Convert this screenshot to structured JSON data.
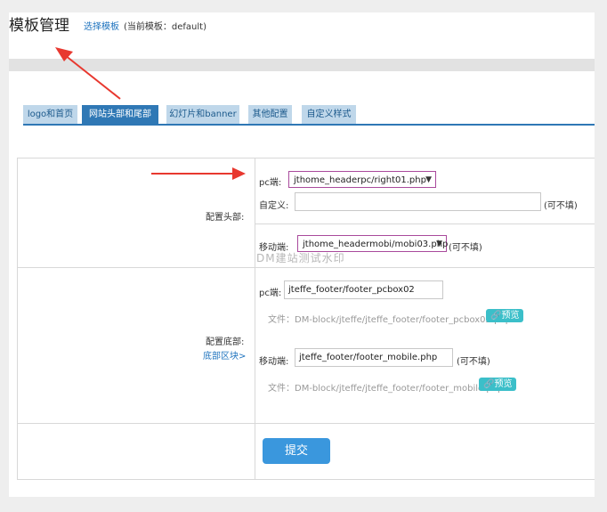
{
  "header": {
    "title": "模板管理",
    "select_link": "选择模板",
    "current_template": "(当前模板：default)"
  },
  "tabs": [
    {
      "label": "logo和首页",
      "active": false
    },
    {
      "label": "网站头部和尾部",
      "active": true
    },
    {
      "label": "幻灯片和banner",
      "active": false
    },
    {
      "label": "其他配置",
      "active": false
    },
    {
      "label": "自定义样式",
      "active": false
    }
  ],
  "header_config": {
    "label": "配置头部:",
    "pc_label": "pc端:",
    "pc_value": "jthome_headerpc/right01.php",
    "custom_label": "自定义:",
    "custom_value": "",
    "custom_hint": "(可不填)",
    "mobile_label": "移动端:",
    "mobile_value": "jthome_headermobi/mobi03.php",
    "mobile_hint": "(可不填)"
  },
  "footer_config": {
    "label": "配置底部:",
    "block_link": "底部区块>",
    "pc_label": "pc端:",
    "pc_value": "jteffe_footer/footer_pcbox02",
    "pc_file": "文件：DM-block/jteffe/jteffe_footer/footer_pcbox02.php",
    "mobile_label": "移动端:",
    "mobile_value": "jteffe_footer/footer_mobile.php",
    "mobile_hint": "(可不填)",
    "mobile_file": "文件：DM-block/jteffe/jteffe_footer/footer_mobile.php",
    "preview_label": "预览"
  },
  "submit_label": "提交",
  "watermark": "DM建站测试水印",
  "colors": {
    "accent": "#2f78b5",
    "tab_inactive": "#bfd7ea",
    "preview": "#3bbfc9",
    "submit": "#3a97dd",
    "arrow": "#e8382f",
    "select_border": "#a94a9c"
  }
}
